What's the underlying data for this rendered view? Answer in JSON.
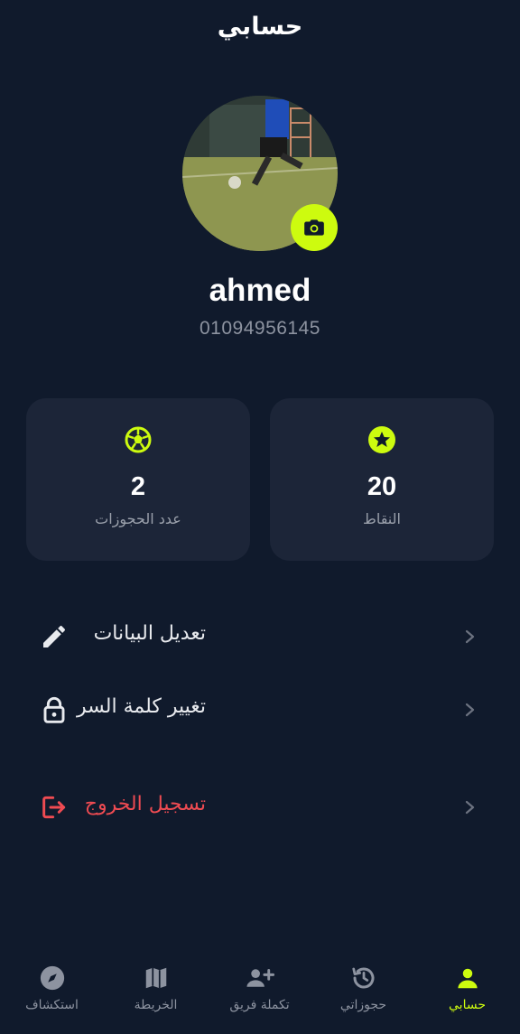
{
  "header": {
    "title": "حسابي"
  },
  "profile": {
    "username": "ahmed",
    "phone": "01094956145"
  },
  "stats": {
    "bookings": {
      "value": "2",
      "label": "عدد الحجوزات",
      "icon": "soccer-ball-icon"
    },
    "points": {
      "value": "20",
      "label": "النقاط",
      "icon": "star-icon"
    }
  },
  "menu": {
    "edit": {
      "label": "تعديل البيانات",
      "icon": "pencil-icon"
    },
    "password": {
      "label": "تغيير كلمة السر",
      "icon": "lock-icon"
    },
    "logout": {
      "label": "تسجيل الخروج",
      "icon": "logout-icon"
    }
  },
  "nav": {
    "explore": {
      "label": "استكشاف",
      "icon": "compass-icon"
    },
    "map": {
      "label": "الخريطة",
      "icon": "map-icon"
    },
    "team": {
      "label": "تكملة فريق",
      "icon": "add-user-icon"
    },
    "bookings": {
      "label": "حجوزاتي",
      "icon": "history-icon"
    },
    "account": {
      "label": "حسابي",
      "icon": "person-icon"
    }
  },
  "colors": {
    "background": "#101a2c",
    "card": "#1c2538",
    "accent": "#cdfb0f",
    "danger": "#ef4b52",
    "muted": "#8d93a0"
  }
}
